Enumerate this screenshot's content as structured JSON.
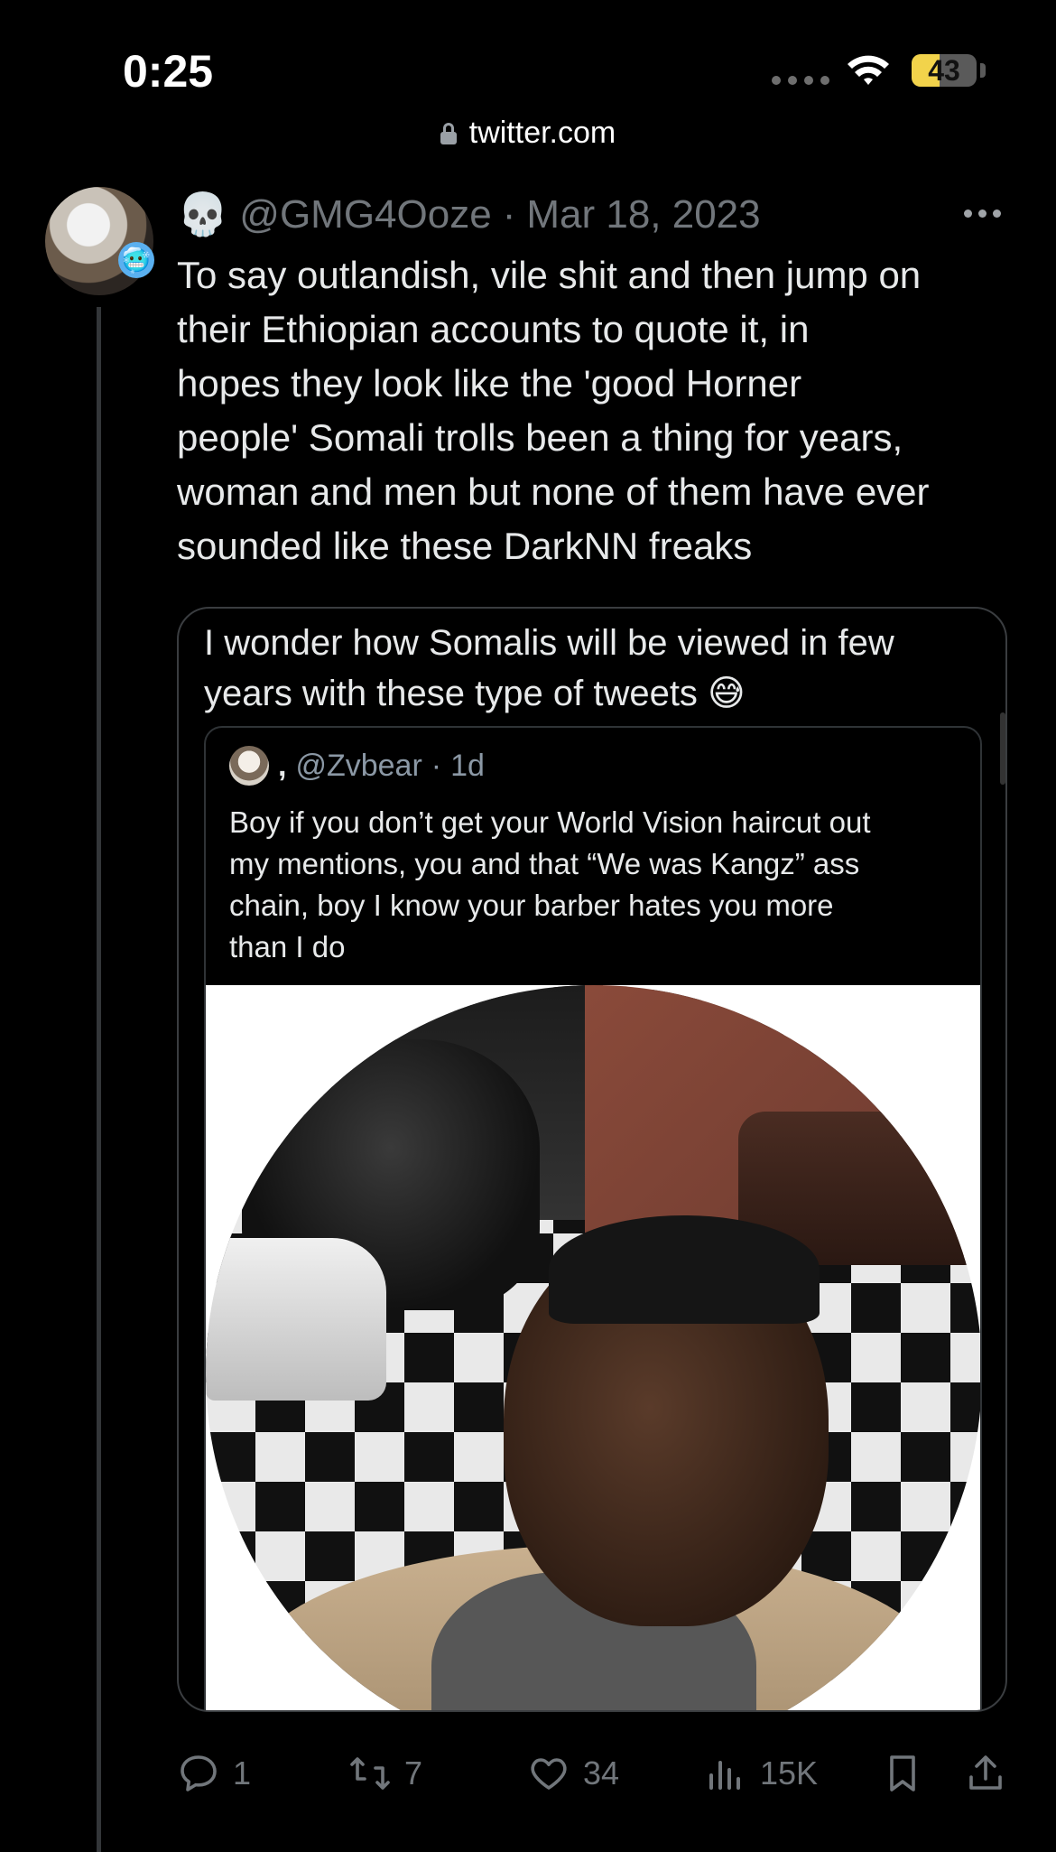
{
  "status_bar": {
    "time": "0:25",
    "battery": "43",
    "battery_level": 0.43,
    "icons": [
      "signal-dots-icon",
      "wifi-icon",
      "battery-icon"
    ]
  },
  "browser": {
    "url": "twitter.com",
    "lock_icon": "lock-icon"
  },
  "tweet": {
    "author_emoji": "💀",
    "handle": "@GMG4Ooze",
    "separator": "·",
    "date": "Mar 18, 2023",
    "badge_emoji": "🥶",
    "text": "To say outlandish, vile shit and then jump on\ntheir Ethiopian accounts to quote it, in\nhopes they look like the 'good Horner\npeople' Somali trolls been a thing for years,\nwoman and men but none of them have ever\nsounded like these DarkNN freaks",
    "quote": {
      "text": "I wonder how Somalis will be viewed in few\nyears with these type of tweets 😅",
      "inner": {
        "comma": ",",
        "handle": "@Zvbear",
        "separator": "·",
        "age": "1d",
        "text": "Boy if you don’t get your World Vision haircut out\nmy mentions, you and that “We was Kangz” ass\nchain, boy I know your barber hates you more\nthan I do"
      }
    },
    "actions": {
      "replies": "1",
      "retweets": "7",
      "likes": "34",
      "views": "15K"
    }
  },
  "colors": {
    "background": "#000000",
    "text": "#e7e9ea",
    "muted": "#71767b",
    "battery": "#f2d34b"
  }
}
